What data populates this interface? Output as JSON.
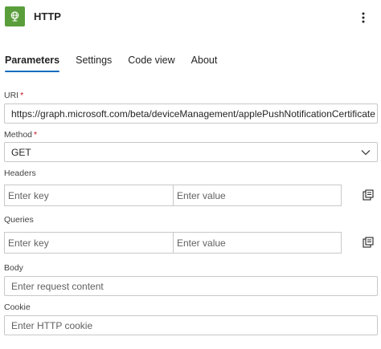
{
  "header": {
    "title": "HTTP",
    "app_icon": "globe-icon",
    "more_icon": "more-vertical-icon",
    "brand_color": "#5a9e3b"
  },
  "tabs": [
    {
      "label": "Parameters",
      "active": true
    },
    {
      "label": "Settings",
      "active": false
    },
    {
      "label": "Code view",
      "active": false
    },
    {
      "label": "About",
      "active": false
    }
  ],
  "uri": {
    "label": "URI",
    "required_mark": "*",
    "value": "https://graph.microsoft.com/beta/deviceManagement/applePushNotificationCertificate"
  },
  "method": {
    "label": "Method",
    "required_mark": "*",
    "value": "GET",
    "icon": "chevron-down-icon"
  },
  "headers": {
    "label": "Headers",
    "key_placeholder": "Enter key",
    "value_placeholder": "Enter value",
    "action_icon": "switch-to-text-mode-icon"
  },
  "queries": {
    "label": "Queries",
    "key_placeholder": "Enter key",
    "value_placeholder": "Enter value",
    "action_icon": "switch-to-text-mode-icon"
  },
  "body": {
    "label": "Body",
    "placeholder": "Enter request content"
  },
  "cookie": {
    "label": "Cookie",
    "placeholder": "Enter HTTP cookie"
  },
  "colors": {
    "accent": "#0f6cbd",
    "required": "#c50f1f"
  }
}
